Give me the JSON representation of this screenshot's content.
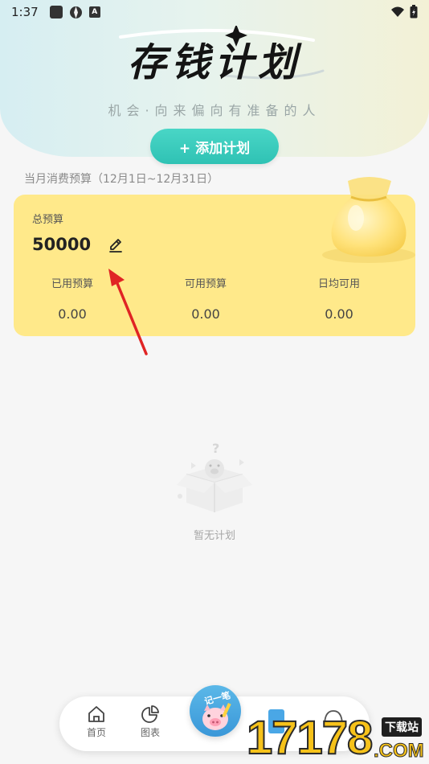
{
  "status_bar": {
    "time": "1:37",
    "a_badge": "A"
  },
  "header": {
    "title": "存钱计划",
    "subtitle": "机会·向来偏向有准备的人",
    "add_button": "+ 添加计划"
  },
  "budget": {
    "period": "当月消费预算（12月1日~12月31日）",
    "total_label": "总预算",
    "total_value": "50000",
    "stats": [
      {
        "label": "已用预算",
        "value": "0.00"
      },
      {
        "label": "可用预算",
        "value": "0.00"
      },
      {
        "label": "日均可用",
        "value": "0.00"
      }
    ]
  },
  "empty": {
    "text": "暂无计划"
  },
  "tabbar": {
    "tabs": [
      {
        "label": "首页",
        "icon": "home-icon"
      },
      {
        "label": "图表",
        "icon": "pie-chart-icon"
      }
    ],
    "center_label": "记一笔"
  },
  "watermark": {
    "brand": "17178",
    "top": "下载站",
    "bottom": ".COM"
  },
  "colors": {
    "card": "#ffe98a",
    "accent": "#2fc2b4",
    "arrow": "#e02424"
  }
}
